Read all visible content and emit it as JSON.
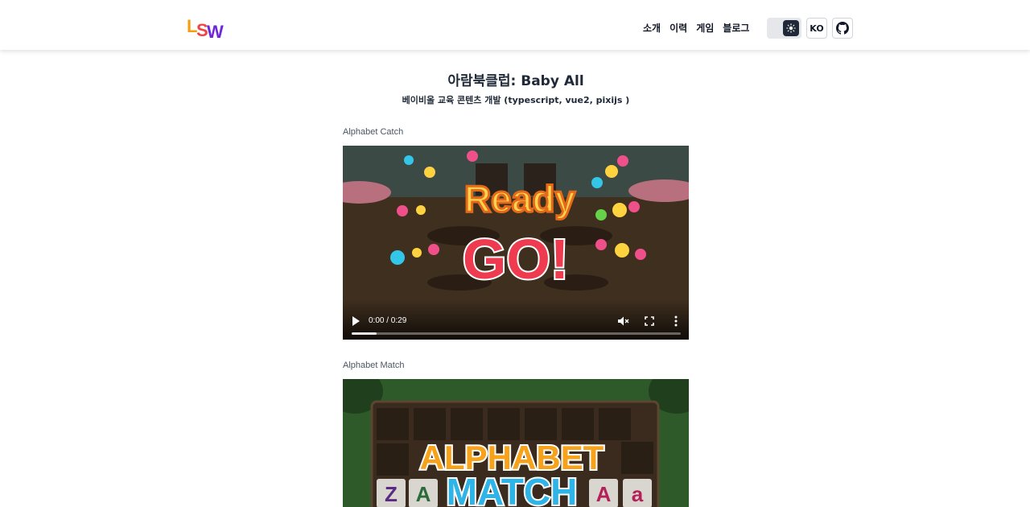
{
  "header": {
    "logo_text": "LSW",
    "nav": [
      "소개",
      "이력",
      "게임",
      "블로그"
    ],
    "lang_label": "KO"
  },
  "page": {
    "title": "아람북클럽: Baby All",
    "subtitle": "베이비올 교육 콘텐츠 개발 (typescript, vue2, pixijs )"
  },
  "videos": [
    {
      "label": "Alphabet Catch",
      "poster_text_1": "Ready",
      "poster_text_2": "GO!",
      "time": "0:00 / 0:29",
      "progress_fraction": 0.075
    },
    {
      "label": "Alphabet Match",
      "poster_text_1": "ALPHABET",
      "poster_text_2": "MATCH"
    }
  ],
  "colors": {
    "ready_fill": "#ffd34d",
    "go_fill": "#ef3b4f",
    "alphabet_fill": "#f7a21b",
    "match_fill": "#2fb4e8"
  },
  "icons": [
    "sun-icon",
    "github-icon",
    "play-icon",
    "mute-icon",
    "fullscreen-icon",
    "more-vertical-icon",
    "star-icon"
  ]
}
